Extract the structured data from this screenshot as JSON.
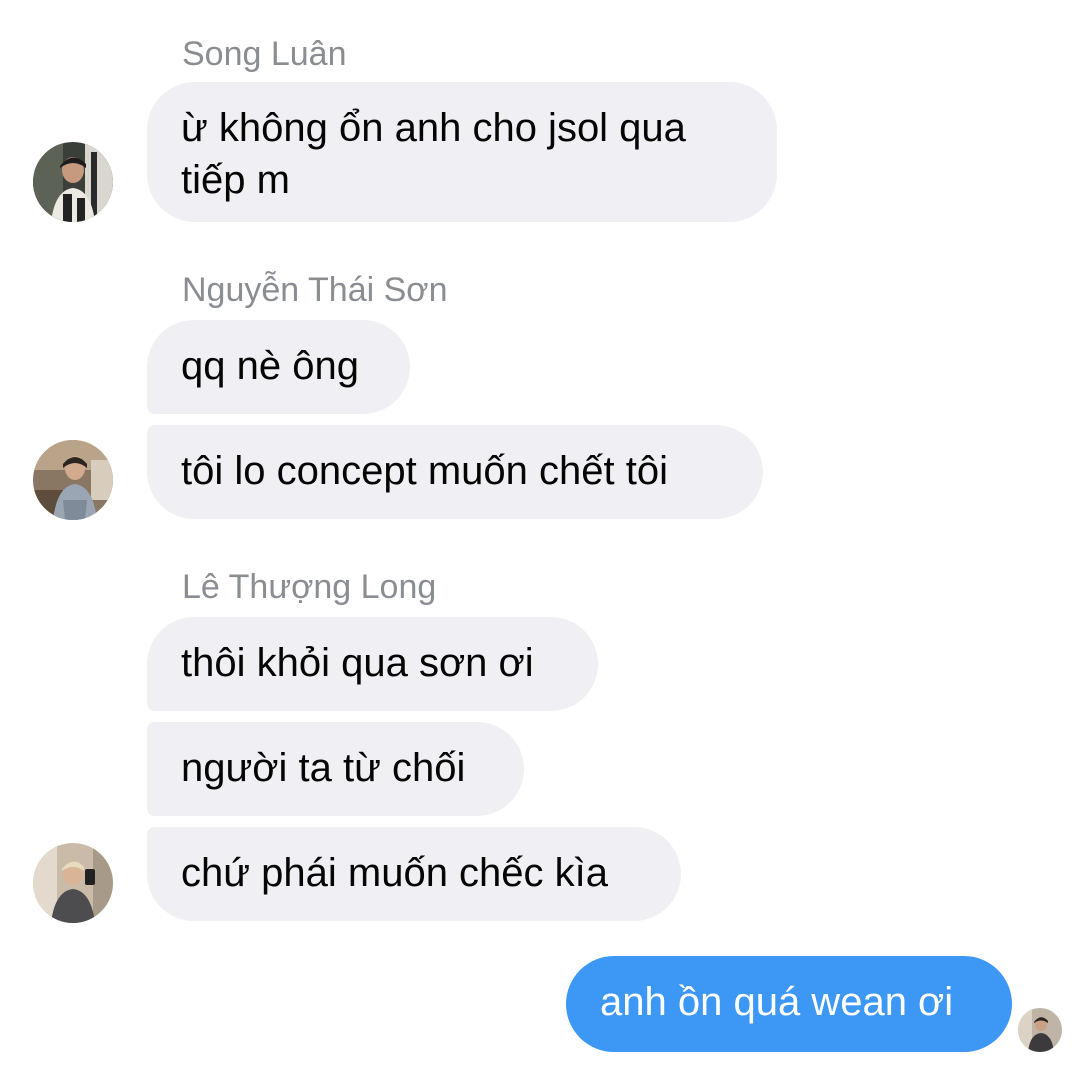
{
  "conversation": {
    "groups": [
      {
        "sender": "Song Luân",
        "messages": [
          "ừ không ổn anh cho jsol qua tiếp m"
        ]
      },
      {
        "sender": "Nguyễn Thái Sơn",
        "messages": [
          "qq nè ông",
          "tôi lo concept muốn chết tôi"
        ]
      },
      {
        "sender": "Lê Thượng Long",
        "messages": [
          "thôi khỏi qua sơn ơi",
          "người ta từ chối",
          "chứ phái muốn chếc kìa"
        ]
      }
    ],
    "outgoing": {
      "messages": [
        "anh ồn quá wean ơi"
      ]
    }
  },
  "avatars": {
    "song_luan": "avatar-photo",
    "nguyen_thai_son": "avatar-photo",
    "le_thuong_long": "avatar-photo",
    "self_read_receipt": "avatar-photo"
  },
  "colors": {
    "incoming_bubble": "#f0f0f4",
    "outgoing_bubble": "#3d97f5",
    "sender_name": "#8a8d91"
  }
}
